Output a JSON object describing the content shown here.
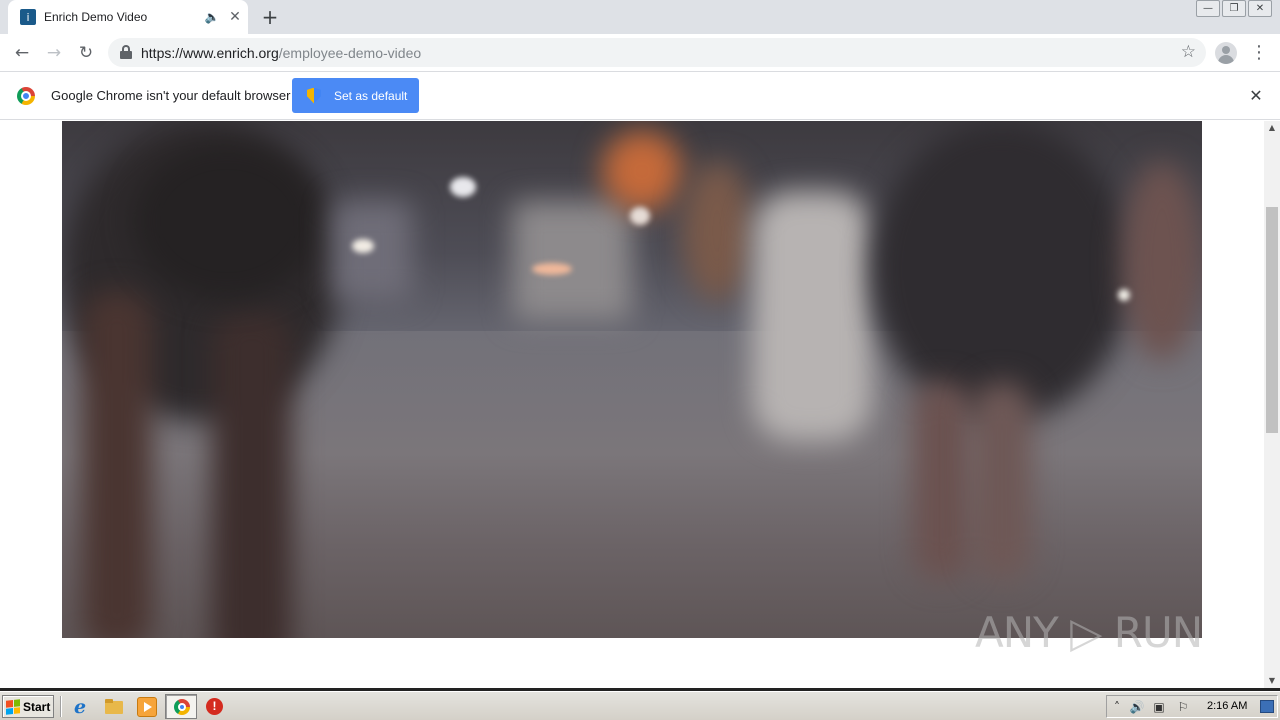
{
  "browser": {
    "tab": {
      "title": "Enrich Demo Video",
      "favicon_icon": "enrich-favicon-icon",
      "audio_icon": "speaker-icon",
      "close_glyph": "✕"
    },
    "new_tab_glyph": "+",
    "window_buttons": [
      "—",
      "❐",
      "✕"
    ],
    "url_host": "https://www.enrich.org",
    "url_path": "/employee-demo-video",
    "nav": {
      "back": "←",
      "forward": "→",
      "reload": "↻"
    },
    "bookmark_glyph": "☆",
    "menu_glyph": "⋮"
  },
  "infobar": {
    "message": "Google Chrome isn't your default browser",
    "button_label": "Set as default",
    "close_glyph": "✕"
  },
  "page": {
    "video_description": "blurred street scene",
    "watermark": "ANY ▷ RUN"
  },
  "scrollbar": {
    "up_glyph": "▲",
    "down_glyph": "▼",
    "position_fraction": 0.23
  },
  "taskbar": {
    "start_label": "Start",
    "clock": "2:16 AM",
    "tray_icons": [
      "chevron-up-icon",
      "volume-icon",
      "network-icon",
      "flag-icon"
    ],
    "pinned": [
      "internet-explorer-icon",
      "folder-icon",
      "media-player-icon",
      "chrome-icon",
      "stop-icon"
    ]
  },
  "colors": {
    "accent_button": "#4b8af5",
    "tab_strip": "#dee1e6",
    "taskbar": "#d4d0c8"
  }
}
